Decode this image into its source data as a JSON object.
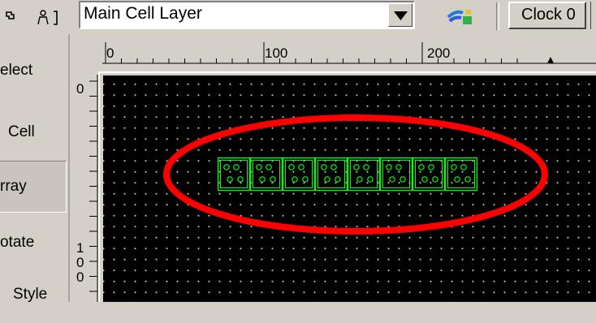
{
  "toolbar": {
    "layer_combo": {
      "value": "Main Cell Layer"
    },
    "clock_button": {
      "label": "Clock 0"
    }
  },
  "palette": {
    "items": [
      {
        "label": "elect"
      },
      {
        "label": "Cell"
      },
      {
        "label": "rray"
      },
      {
        "label": "otate"
      },
      {
        "label": "Style"
      }
    ],
    "selected_label": "rray"
  },
  "ruler": {
    "top_labels": [
      "0",
      "100",
      "200"
    ],
    "left_labels": [
      "0",
      "1",
      "0",
      "0"
    ]
  },
  "canvas": {
    "background": "#000000",
    "grid_dot_color": "#b8b8b8",
    "cell_outline_color": "#00ff00",
    "highlight_ellipse_color": "#ff0000",
    "array_cell_count": 8
  },
  "colors": {
    "window_face": "#d4d0c8",
    "shadow": "#808080",
    "highlight": "#ffffff"
  }
}
